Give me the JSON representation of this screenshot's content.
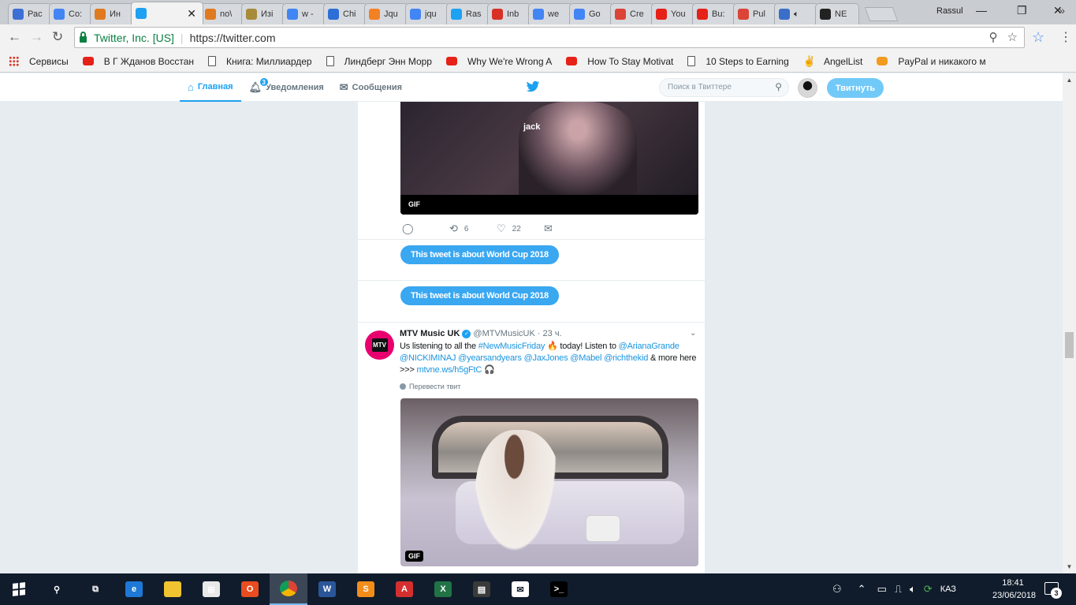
{
  "browser": {
    "tabs": [
      {
        "label": "Рас",
        "icon": "puzzle-icon",
        "color": "#3b6fd4"
      },
      {
        "label": "Co:",
        "icon": "google-icon",
        "color": "#4285f4"
      },
      {
        "label": "Ин",
        "icon": "drive-icon",
        "color": "#e07a1f"
      },
      {
        "label": "",
        "icon": "twitter-icon",
        "color": "#1da1f2",
        "active": true
      },
      {
        "label": "no\\",
        "icon": "drive-icon",
        "color": "#e07a1f"
      },
      {
        "label": "Изі",
        "icon": "coin-icon",
        "color": "#a88b3a"
      },
      {
        "label": "w -",
        "icon": "google-icon",
        "color": "#4285f4"
      },
      {
        "label": "Chi",
        "icon": "wave-icon",
        "color": "#2d6fd6"
      },
      {
        "label": "Jqu",
        "icon": "stackoverflow-icon",
        "color": "#f48024"
      },
      {
        "label": "jqu",
        "icon": "google-icon",
        "color": "#4285f4"
      },
      {
        "label": "Ras",
        "icon": "twitter-icon",
        "color": "#1da1f2"
      },
      {
        "label": "Inb",
        "icon": "gmail-icon",
        "color": "#d93025"
      },
      {
        "label": "we",
        "icon": "google-icon",
        "color": "#4285f4"
      },
      {
        "label": "Go",
        "icon": "google-icon",
        "color": "#4285f4"
      },
      {
        "label": "Cre",
        "icon": "chrome-icon",
        "color": "#db4437"
      },
      {
        "label": "You",
        "icon": "youtube-icon",
        "color": "#e62117"
      },
      {
        "label": "Bu:",
        "icon": "youtube-icon",
        "color": "#e62117"
      },
      {
        "label": "Pul",
        "icon": "chrome-icon",
        "color": "#db4437"
      },
      {
        "label": "",
        "icon": "play-icon",
        "color": "#3a6fc9",
        "audio": true
      },
      {
        "label": "NE",
        "icon": "power-icon",
        "color": "#222222"
      }
    ],
    "active_tab_close": "✕",
    "profile_name": "Rassul",
    "window_minimize": "—",
    "window_restore": "❐",
    "window_close": "✕",
    "back": "←",
    "forward": "→",
    "reload": "↻",
    "site_identity": "Twitter, Inc. [US]",
    "url": "https://twitter.com",
    "zoom_icon": "⚲",
    "star": "☆",
    "menu": "⋮",
    "bookmarks": [
      {
        "label": "Сервисы",
        "icon": "apps-grid-icon",
        "kind": "grid"
      },
      {
        "label": "В Г Жданов Восстан",
        "icon": "youtube-icon",
        "kind": "yt"
      },
      {
        "label": "Книга: Миллиардер",
        "icon": "page-icon",
        "kind": "doc"
      },
      {
        "label": "Линдберг Энн Морр",
        "icon": "page-icon",
        "kind": "doc"
      },
      {
        "label": "Why We're Wrong A",
        "icon": "youtube-icon",
        "kind": "yt"
      },
      {
        "label": "How To Stay Motivat",
        "icon": "youtube-icon",
        "kind": "yt"
      },
      {
        "label": "10 Steps to Earning",
        "icon": "page-icon",
        "kind": "doc"
      },
      {
        "label": "AngelList",
        "icon": "angellist-icon",
        "kind": "al"
      },
      {
        "label": "PayPal и никакого м",
        "icon": "paypal-icon",
        "kind": "pp"
      }
    ],
    "bookmarks_more": "»"
  },
  "twitter": {
    "nav": {
      "home": "Главная",
      "notifications": "Уведомления",
      "notifications_count": "3",
      "messages": "Сообщения"
    },
    "search_placeholder": "Поиск в Твиттере",
    "tweet_button": "Твитнуть",
    "timeline": {
      "top_gif_caption": "jack",
      "gif_badge": "GIF",
      "retweet_count": "6",
      "like_count": "22",
      "topic_pill_1": "This tweet is about World Cup 2018",
      "topic_pill_2": "This tweet is about World Cup 2018",
      "tweet": {
        "avatar_text": "MTV",
        "name": "MTV Music UK",
        "handle": "@MTVMusicUK",
        "time": "· 23 ч.",
        "text_parts": [
          {
            "t": "Us listening to all the ",
            "link": false
          },
          {
            "t": "#NewMusicFriday",
            "link": true
          },
          {
            "t": " 🔥 today! Listen to ",
            "link": false
          },
          {
            "t": "@ArianaGrande",
            "link": true
          },
          {
            "t": " ",
            "link": false
          },
          {
            "t": "@NICKIMINAJ",
            "link": true
          },
          {
            "t": " ",
            "link": false
          },
          {
            "t": "@yearsandyears",
            "link": true
          },
          {
            "t": " ",
            "link": false
          },
          {
            "t": "@JaxJones",
            "link": true
          },
          {
            "t": " ",
            "link": false
          },
          {
            "t": "@Mabel",
            "link": true
          },
          {
            "t": " ",
            "link": false
          },
          {
            "t": "@richthekid",
            "link": true
          },
          {
            "t": " & more here >>> ",
            "link": false
          },
          {
            "t": "mtvne.ws/h5gFtC",
            "link": true
          },
          {
            "t": " 🎧",
            "link": false
          }
        ],
        "translate": "Перевести твит",
        "gif_badge": "GIF"
      }
    }
  },
  "taskbar": {
    "apps": [
      {
        "name": "search",
        "glyph": "⚲",
        "color": "transparent"
      },
      {
        "name": "task-view",
        "glyph": "⧉",
        "color": "transparent"
      },
      {
        "name": "edge",
        "glyph": "e",
        "color": "#1e78d6"
      },
      {
        "name": "file-explorer",
        "glyph": "",
        "color": "#f0c330"
      },
      {
        "name": "store",
        "glyph": "⊞",
        "color": "#e8e8e8"
      },
      {
        "name": "office",
        "glyph": "O",
        "color": "#e84c1f"
      },
      {
        "name": "chrome",
        "glyph": "",
        "color": "#db4437",
        "active": true
      },
      {
        "name": "word",
        "glyph": "W",
        "color": "#2b579a"
      },
      {
        "name": "sublime",
        "glyph": "S",
        "color": "#f28d1a"
      },
      {
        "name": "acrobat",
        "glyph": "A",
        "color": "#d32f2f"
      },
      {
        "name": "excel",
        "glyph": "X",
        "color": "#217346"
      },
      {
        "name": "video",
        "glyph": "▤",
        "color": "#3a3a3a"
      },
      {
        "name": "mail",
        "glyph": "✉",
        "color": "#ffffff"
      },
      {
        "name": "terminal",
        "glyph": ">_",
        "color": "#000000"
      }
    ],
    "language": "КАЗ",
    "time": "18:41",
    "date": "23/06/2018",
    "notifications_count": "3"
  }
}
